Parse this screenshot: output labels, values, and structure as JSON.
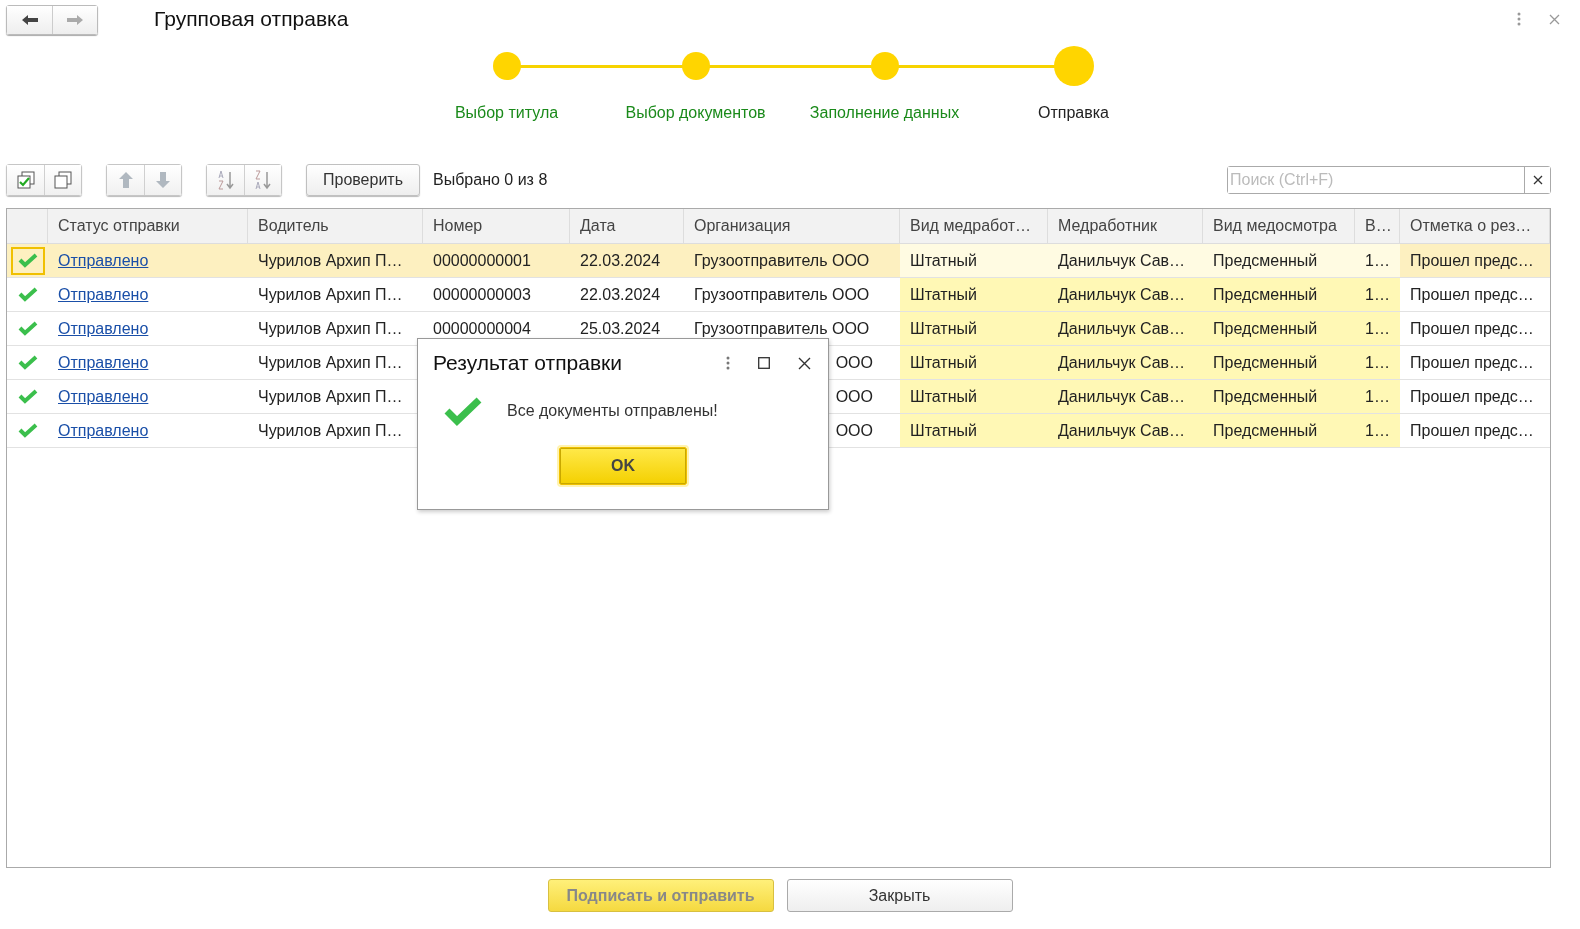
{
  "window": {
    "title": "Групповая отправка"
  },
  "steps": [
    {
      "label": "Выбор титула",
      "completed": true,
      "selected": false
    },
    {
      "label": "Выбор документов",
      "completed": true,
      "selected": false
    },
    {
      "label": "Заполнение данных",
      "completed": true,
      "selected": false
    },
    {
      "label": "Отправка",
      "completed": false,
      "selected": true
    }
  ],
  "toolbar": {
    "check_button": "Проверить",
    "selection_info": "Выбрано 0 из 8",
    "search": {
      "placeholder": "Поиск (Ctrl+F)"
    }
  },
  "table": {
    "columns": [
      {
        "label": "Статус отправки",
        "highlighted": false
      },
      {
        "label": "Водитель",
        "highlighted": false
      },
      {
        "label": "Номер",
        "highlighted": false
      },
      {
        "label": "Дата",
        "highlighted": false
      },
      {
        "label": "Организация",
        "highlighted": false
      },
      {
        "label": "Вид медработ…",
        "highlighted": true
      },
      {
        "label": "Медработник",
        "highlighted": true
      },
      {
        "label": "Вид медосмотра",
        "highlighted": true
      },
      {
        "label": "В…",
        "highlighted": true
      },
      {
        "label": "Отметка о рез…",
        "highlighted": false
      }
    ],
    "rows": [
      {
        "selected": true,
        "covered": false,
        "sent": true,
        "cells": [
          "Отправлено",
          "Чурилов Архип  П…",
          "00000000001",
          "22.03.2024",
          "Грузоотправитель ООО",
          "Штатный",
          "Данильчук Сав…",
          "Предсменный",
          "1…",
          "Прошел предс…"
        ]
      },
      {
        "selected": false,
        "covered": false,
        "sent": true,
        "cells": [
          "Отправлено",
          "Чурилов Архип П…",
          "00000000003",
          "22.03.2024",
          "Грузоотправитель ООО",
          "Штатный",
          "Данильчук Сав…",
          "Предсменный",
          "1…",
          "Прошел предс…"
        ]
      },
      {
        "selected": false,
        "covered": false,
        "sent": true,
        "cells": [
          "Отправлено",
          "Чурилов Архип П…",
          "00000000004",
          "25.03.2024",
          "Грузоотправитель ООО",
          "Штатный",
          "Данильчук Сав…",
          "Предсменный",
          "1…",
          "Прошел предс…"
        ]
      },
      {
        "selected": false,
        "covered": true,
        "sent": true,
        "cells": [
          "Отправлено",
          "Чурилов Архип П…",
          "ООО",
          "Штатный",
          "Данильчук Сав…",
          "Предсменный",
          "1…",
          "Прошел предс…"
        ]
      },
      {
        "selected": false,
        "covered": true,
        "sent": true,
        "cells": [
          "Отправлено",
          "Чурилов Архип П…",
          "ООО",
          "Штатный",
          "Данильчук Сав…",
          "Предсменный",
          "1…",
          "Прошел предс…"
        ]
      },
      {
        "selected": false,
        "covered": true,
        "sent": true,
        "cells": [
          "Отправлено",
          "Чурилов Архип П…",
          "ООО",
          "Штатный",
          "Данильчук Сав…",
          "Предсменный",
          "1…",
          "Прошел предс…"
        ]
      }
    ]
  },
  "dialog": {
    "title": "Результат отправки",
    "message": "Все документы отправлены!",
    "ok_button": "OK"
  },
  "footer": {
    "buttons": [
      {
        "label": "Подписать и отправить",
        "kind": "primary",
        "disabled": true
      },
      {
        "label": "Закрыть",
        "kind": "normal",
        "disabled": false
      }
    ]
  }
}
